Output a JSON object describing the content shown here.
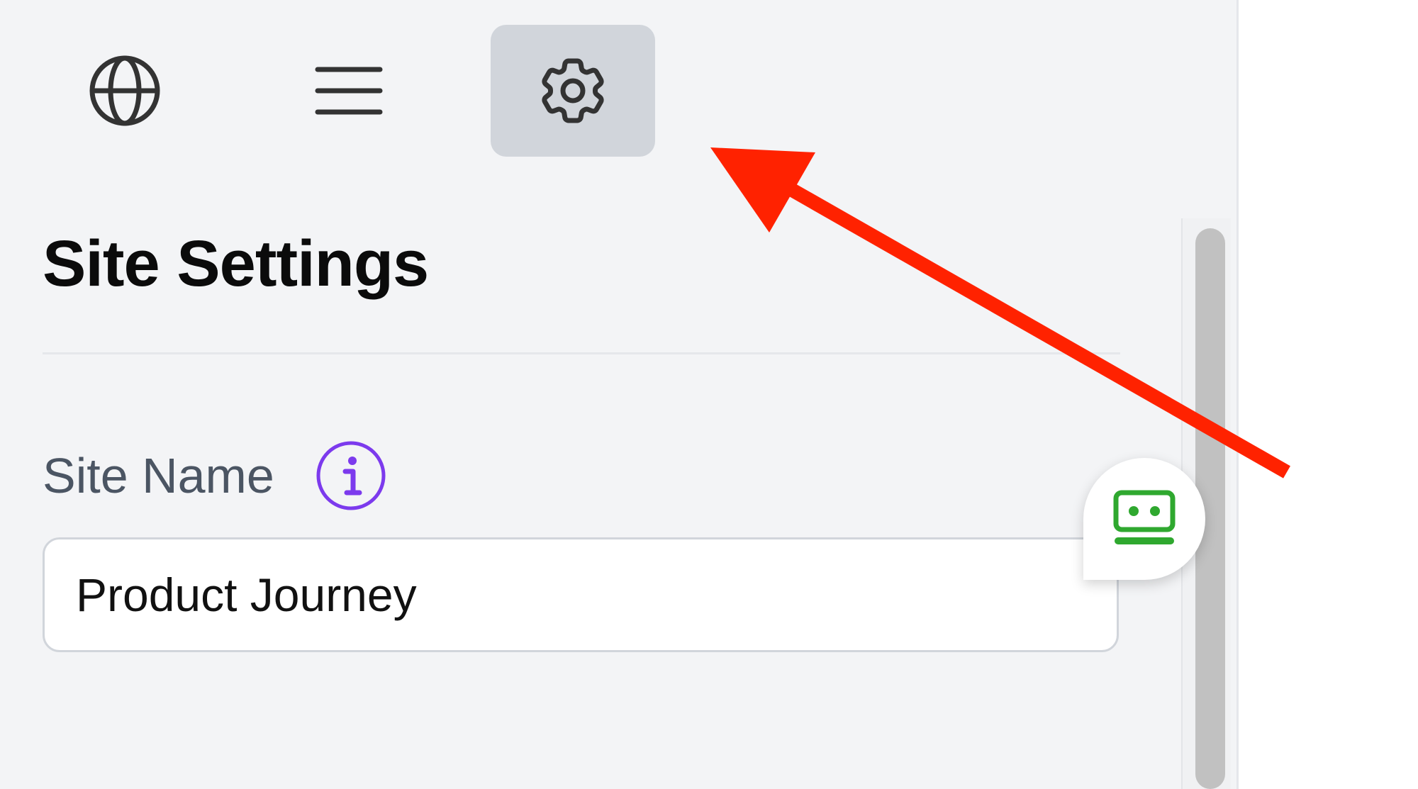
{
  "toolbar": {
    "buttons": [
      {
        "icon": "globe-icon",
        "active": false
      },
      {
        "icon": "menu-icon",
        "active": false
      },
      {
        "icon": "gear-icon",
        "active": true
      }
    ]
  },
  "page": {
    "title": "Site Settings"
  },
  "site_name": {
    "label": "Site Name",
    "info_icon": "info-icon",
    "value": "Product Journey"
  },
  "helper": {
    "icon": "assistant-icon"
  },
  "annotation": {
    "icon": "red-arrow",
    "color": "#ff2200"
  },
  "colors": {
    "panel_bg": "#f3f4f6",
    "active_button_bg": "#d1d5db",
    "info_accent": "#7c3aed",
    "helper_accent": "#2fa82f"
  }
}
